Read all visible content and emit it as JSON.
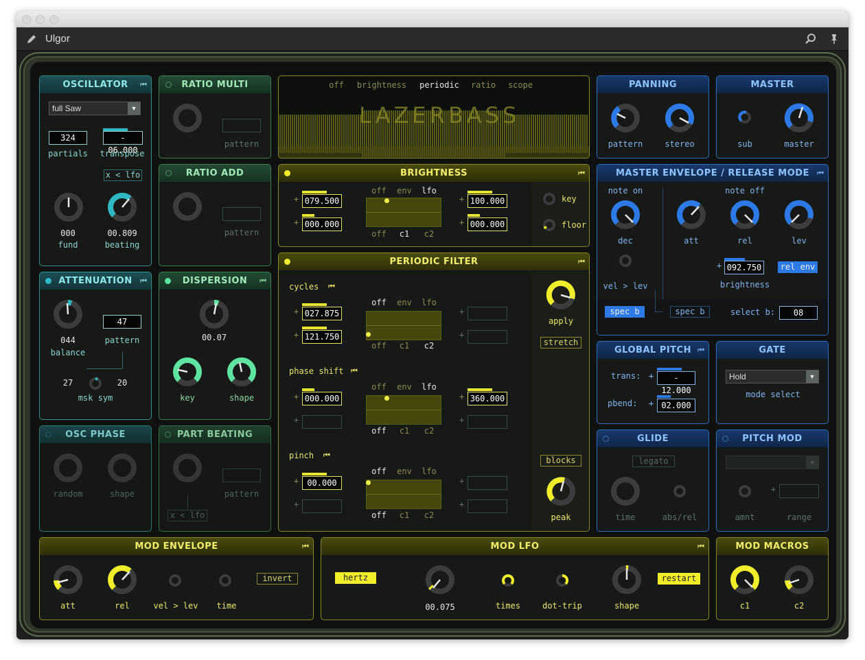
{
  "window": {
    "title": "Ulgor"
  },
  "oscillator": {
    "title": "OSCILLATOR",
    "wave_select": "full Saw",
    "partials_value": "324",
    "partials_label": "partials",
    "transpose_value": "- 06.000",
    "transpose_label": "transpose",
    "xlfo_label": "x < lfo",
    "fund_value": "000",
    "fund_label": "fund",
    "beating_value": "00.809",
    "beating_label": "beating"
  },
  "ratio_multi": {
    "title": "RATIO MULTI",
    "pattern_label": "pattern"
  },
  "ratio_add": {
    "title": "RATIO ADD",
    "pattern_label": "pattern"
  },
  "display": {
    "tabs": [
      "off",
      "brightness",
      "periodic",
      "ratio",
      "scope"
    ],
    "active_tab": "periodic",
    "logo": "LAZERBASS"
  },
  "panning": {
    "title": "PANNING",
    "pattern_label": "pattern",
    "stereo_label": "stereo"
  },
  "master": {
    "title": "MASTER",
    "sub_label": "sub",
    "master_label": "master"
  },
  "brightness": {
    "title": "BRIGHTNESS",
    "val1": "079.500",
    "val2": "000.000",
    "val3": "100.000",
    "val4": "000.000",
    "mod_top": [
      "off",
      "env",
      "lfo"
    ],
    "mod_bot": [
      "off",
      "c1",
      "c2"
    ],
    "key_label": "key",
    "floor_label": "floor"
  },
  "periodic_filter": {
    "title": "PERIODIC FILTER",
    "cycles_label": "cycles",
    "cycles_val1": "027.875",
    "cycles_val2": "121.750",
    "phase_label": "phase shift",
    "phase_val1": "000.000",
    "phase_val2": "360.000",
    "pinch_label": "pinch",
    "pinch_val1": "00.000",
    "mod_top": [
      "off",
      "env",
      "lfo"
    ],
    "mod_bot": [
      "off",
      "c1",
      "c2"
    ],
    "apply_label": "apply",
    "stretch_label": "stretch",
    "blocks_label": "blocks",
    "peak_label": "peak"
  },
  "master_env": {
    "title": "MASTER ENVELOPE / RELEASE MODE",
    "note_on": "note on",
    "note_off": "note off",
    "dec_label": "dec",
    "att_label": "att",
    "rel_label": "rel",
    "lev_label": "lev",
    "vel_lev_label": "vel > lev",
    "brightness_value": "092.750",
    "brightness_label": "brightness",
    "rel_env_label": "rel env",
    "spec_b_1": "spec b",
    "spec_b_2": "spec b",
    "select_b_label": "select b:",
    "select_b_value": "08"
  },
  "attenuation": {
    "title": "ATTENUATION",
    "balance_value": "044",
    "balance_label": "balance",
    "pattern_value": "47",
    "pattern_label": "pattern",
    "msk_left": "27",
    "msk_right": "20",
    "msk_label": "msk sym"
  },
  "dispersion": {
    "title": "DISPERSION",
    "value": "00.07",
    "key_label": "key",
    "shape_label": "shape"
  },
  "global_pitch": {
    "title": "GLOBAL PITCH",
    "trans_label": "trans:",
    "trans_value": "- 12.000",
    "pbend_label": "pbend:",
    "pbend_value": "02.000"
  },
  "gate": {
    "title": "GATE",
    "mode_value": "Hold",
    "mode_label": "mode select"
  },
  "osc_phase": {
    "title": "OSC PHASE",
    "random_label": "random",
    "shape_label": "shape"
  },
  "part_beating": {
    "title": "PART BEATING",
    "pattern_label": "pattern",
    "xlfo_label": "x < lfo"
  },
  "glide": {
    "title": "GLIDE",
    "legato_label": "legato",
    "time_label": "time",
    "absrel_label": "abs/rel"
  },
  "pitch_mod": {
    "title": "PITCH MOD",
    "amnt_label": "amnt",
    "range_label": "range"
  },
  "mod_envelope": {
    "title": "MOD ENVELOPE",
    "att_label": "att",
    "rel_label": "rel",
    "vel_lev_label": "vel > lev",
    "time_label": "time",
    "invert_label": "invert"
  },
  "mod_lfo": {
    "title": "MOD LFO",
    "hertz_label": "hertz",
    "rate_value": "00.075",
    "times_label": "times",
    "dottrip_label": "dot-trip",
    "shape_label": "shape",
    "restart_label": "restart"
  },
  "mod_macros": {
    "title": "MOD MACROS",
    "c1_label": "c1",
    "c2_label": "c2"
  },
  "colors": {
    "teal": "#2fb8c4",
    "yellow": "#f0ee2a",
    "blue": "#2d7ae6",
    "green": "#5fe3a0"
  }
}
